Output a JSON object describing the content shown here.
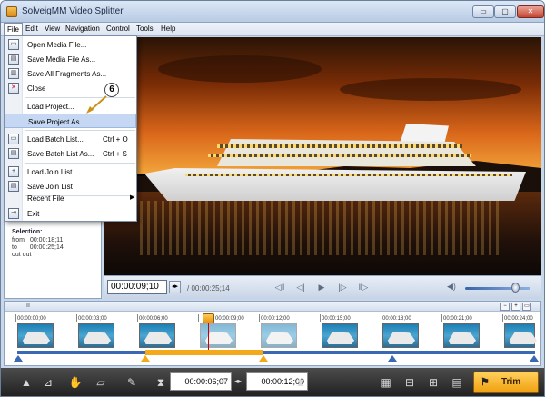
{
  "window": {
    "title": "SolveigMM Video Splitter",
    "min_label": "▭",
    "max_label": "▢",
    "close_label": "✕"
  },
  "menubar": {
    "items": [
      "File",
      "Edit",
      "View",
      "Navigation",
      "Control",
      "Tools",
      "Help"
    ]
  },
  "file_menu": {
    "items": [
      {
        "label": "Open Media File...",
        "shortcut": "",
        "icon": "open-icon"
      },
      {
        "label": "Save Media File As...",
        "shortcut": "",
        "icon": "save-icon"
      },
      {
        "label": "Save All Fragments As...",
        "shortcut": "",
        "icon": "save-all-icon"
      },
      {
        "label": "Close",
        "shortcut": "",
        "icon": "close-file-icon"
      },
      {
        "label": "Load Project...",
        "shortcut": "",
        "icon": ""
      },
      {
        "label": "Save Project As...",
        "shortcut": "",
        "icon": ""
      },
      {
        "label": "Load Batch List...",
        "shortcut": "Ctrl + O",
        "icon": "load-batch-icon"
      },
      {
        "label": "Save Batch List As...",
        "shortcut": "Ctrl + S",
        "icon": "save-batch-icon"
      },
      {
        "label": "Load Join List",
        "shortcut": "",
        "icon": "load-join-icon"
      },
      {
        "label": "Save Join List",
        "shortcut": "",
        "icon": "save-join-icon"
      },
      {
        "label": "Recent File",
        "shortcut": "",
        "icon": ""
      },
      {
        "label": "Exit",
        "shortcut": "",
        "icon": "exit-icon"
      }
    ],
    "highlighted": "Save Project As..."
  },
  "callout": {
    "number": "6"
  },
  "selection": {
    "title": "Selection:",
    "from_label": "from",
    "from_value": "00:00:18;11",
    "to_label": "to",
    "to_value": "00:00:25;14",
    "extra": "out out"
  },
  "player": {
    "current_time": "00:00:09;10",
    "duration": "/ 00:00:25;14",
    "spin_label": "◂▸",
    "volume_level": 0.78
  },
  "timeline": {
    "ticks": [
      "00:00:00;00",
      "00:00:03;00",
      "00:00:06;00",
      "00:00:09;00",
      "00:00:12;00",
      "00:00:15;00",
      "00:00:18;00",
      "00:00:21;00",
      "00:00:24;00"
    ],
    "pause_label": "II"
  },
  "bottombar": {
    "start_time": "00:00:06;07",
    "end_time": "00:00:12;00",
    "trim_label": "Trim",
    "spin_label": "◂▸"
  }
}
